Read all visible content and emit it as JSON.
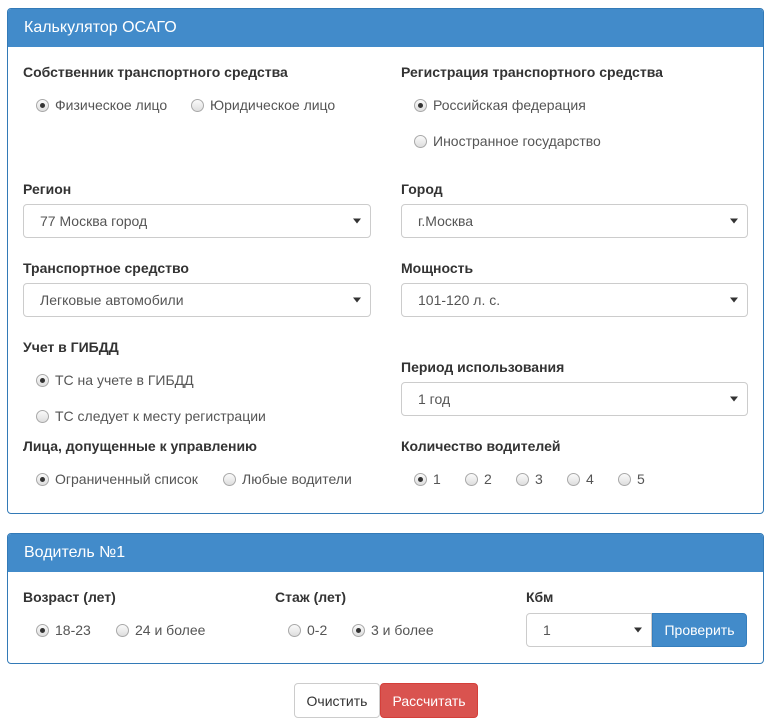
{
  "calc": {
    "title": "Калькулятор ОСАГО",
    "owner": {
      "label": "Собственник транспортного средства",
      "options": [
        "Физическое лицо",
        "Юридическое лицо"
      ],
      "selected": 0
    },
    "registration": {
      "label": "Регистрация транспортного средства",
      "options": [
        "Российская федерация",
        "Иностранное государство"
      ],
      "selected": 0
    },
    "region": {
      "label": "Регион",
      "value": "77 Москва город"
    },
    "city": {
      "label": "Город",
      "value": "г.Москва"
    },
    "vehicle": {
      "label": "Транспортное средство",
      "value": "Легковые автомобили"
    },
    "power": {
      "label": "Мощность",
      "value": "101-120 л. с."
    },
    "gibdd": {
      "label": "Учет в ГИБДД",
      "options": [
        "ТС на учете в ГИБДД",
        "ТС следует к месту регистрации"
      ],
      "selected": 0
    },
    "period": {
      "label": "Период использования",
      "value": "1 год"
    },
    "persons": {
      "label": "Лица, допущенные к управлению",
      "options": [
        "Ограниченный список",
        "Любые водители"
      ],
      "selected": 0
    },
    "drivers_count": {
      "label": "Количество водителей",
      "options": [
        "1",
        "2",
        "3",
        "4",
        "5"
      ],
      "selected": 0
    }
  },
  "driver": {
    "title": "Водитель №1",
    "age": {
      "label": "Возраст (лет)",
      "options": [
        "18-23",
        "24 и более"
      ],
      "selected": 0
    },
    "experience": {
      "label": "Стаж (лет)",
      "options": [
        "0-2",
        "3 и более"
      ],
      "selected": 1
    },
    "kbm": {
      "label": "Кбм",
      "value": "1",
      "check_label": "Проверить"
    }
  },
  "actions": {
    "clear_label": "Очистить",
    "calculate_label": "Рассчитать"
  },
  "colors": {
    "panel_heading": "#428bca",
    "panel_border": "#337ab7",
    "danger": "#d9534f"
  }
}
